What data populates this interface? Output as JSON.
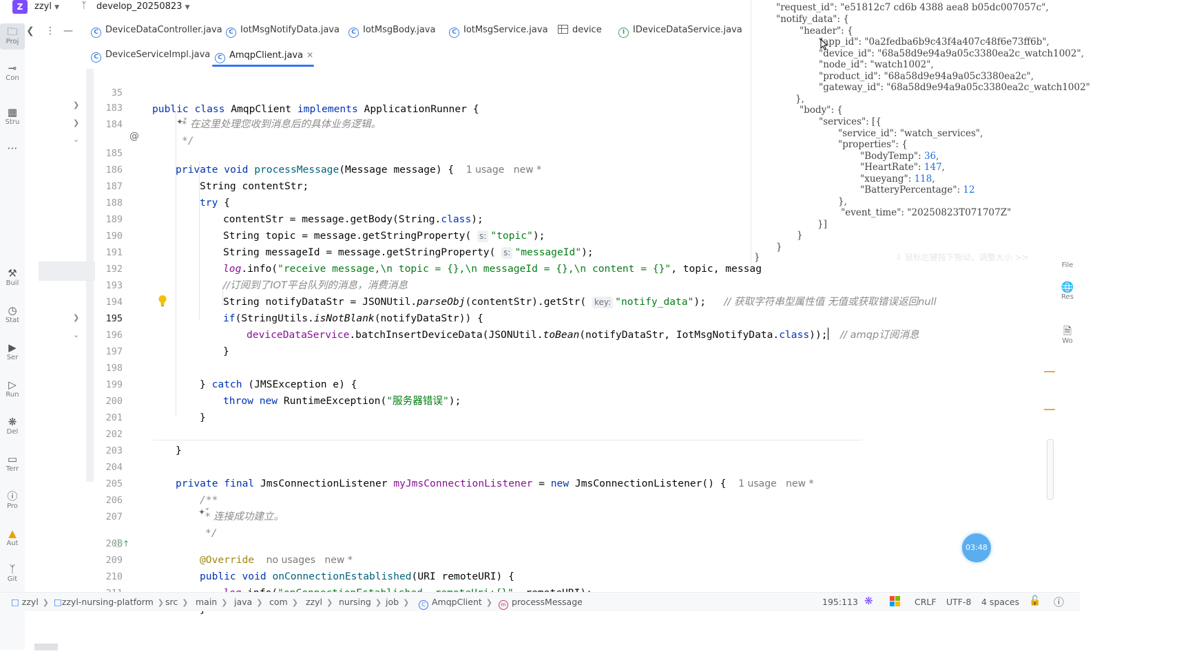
{
  "topbar": {
    "project_letter": "Z",
    "project_name": "zzyl",
    "branch": "develop_20250823"
  },
  "toolstrip": [
    {
      "name": "project",
      "label": "Proj"
    },
    {
      "name": "commit",
      "label": "Con"
    },
    {
      "name": "structure",
      "label": "Stru"
    },
    {
      "name": "more",
      "label": ""
    },
    {
      "name": "build",
      "label": "Buil"
    },
    {
      "name": "statistic",
      "label": "Stat"
    },
    {
      "name": "services",
      "label": "Ser"
    },
    {
      "name": "run",
      "label": "Run"
    },
    {
      "name": "debug",
      "label": "Del"
    },
    {
      "name": "terminal",
      "label": "Terr"
    },
    {
      "name": "problems",
      "label": "Pro"
    },
    {
      "name": "auto",
      "label": "Aut"
    },
    {
      "name": "git",
      "label": "Git"
    }
  ],
  "tabs_row1": [
    {
      "label": "DeviceDataController.java",
      "kind": "class"
    },
    {
      "label": "IotMsgNotifyData.java",
      "kind": "class"
    },
    {
      "label": "IotMsgBody.java",
      "kind": "class"
    },
    {
      "label": "IotMsgService.java",
      "kind": "class"
    },
    {
      "label": "device",
      "kind": "table"
    },
    {
      "label": "IDeviceDataService.java",
      "kind": "interface"
    }
  ],
  "tabs_row2": [
    {
      "label": "DeviceServiceImpl.java",
      "kind": "class"
    },
    {
      "label": "AmqpClient.java",
      "kind": "class",
      "active": true
    }
  ],
  "editor": {
    "lines": [
      {
        "n": "35",
        "code": "public class AmqpClient implements ApplicationRunner {"
      },
      {
        "n": "183",
        "code": "* 在这里处理您收到消息后的具体业务逻辑。"
      },
      {
        "n": "184",
        "code": "*/"
      },
      {
        "n": "185",
        "code": "private void processMessage(Message message) {",
        "hint": "1 usage   new *"
      },
      {
        "n": "186",
        "code": "String contentStr;"
      },
      {
        "n": "187",
        "code": "try {"
      },
      {
        "n": "188",
        "code": "contentStr = message.getBody(String.class);"
      },
      {
        "n": "189",
        "code": "String topic = message.getStringProperty( s: \"topic\");"
      },
      {
        "n": "190",
        "code": "String messageId = message.getStringProperty( s: \"messageId\");"
      },
      {
        "n": "191",
        "code": "log.info(\"receive message,\\n topic = {},\\n messageId = {},\\n content = {}\", topic, messag"
      },
      {
        "n": "192",
        "code": "//订阅到了IOT平台队列的消息，消费消息"
      },
      {
        "n": "193",
        "code": "String notifyDataStr = JSONUtil.parseObj(contentStr).getStr( key: \"notify_data\");",
        "comment": "// 获取字符串型属性值 无值或获取错误返回null"
      },
      {
        "n": "194",
        "code": "if(StringUtils.isNotBlank(notifyDataStr)) {"
      },
      {
        "n": "195",
        "code": "deviceDataService.batchInsertDeviceData(JSONUtil.toBean(notifyDataStr, IotMsgNotifyData.class));",
        "comment": "// amqp订阅消息"
      },
      {
        "n": "196",
        "code": "}"
      },
      {
        "n": "197",
        "code": ""
      },
      {
        "n": "198",
        "code": "} catch (JMSException e) {"
      },
      {
        "n": "199",
        "code": "throw new RuntimeException(\"服务器错误\");"
      },
      {
        "n": "200",
        "code": "}"
      },
      {
        "n": "201",
        "code": ""
      },
      {
        "n": "202",
        "code": "}"
      },
      {
        "n": "203",
        "code": ""
      },
      {
        "n": "204",
        "code": "private final JmsConnectionListener myJmsConnectionListener = new JmsConnectionListener() {",
        "hint": "1 usage   new *"
      },
      {
        "n": "205",
        "code": "/**"
      },
      {
        "n": "206",
        "code": "* 连接成功建立。"
      },
      {
        "n": "207",
        "code": "*/"
      },
      {
        "n": "208",
        "code": "@Override",
        "hint": "no usages   new *"
      },
      {
        "n": "209",
        "code": "public void onConnectionEstablished(URI remoteURI) {"
      },
      {
        "n": "210",
        "code": "log.info(\"onConnectionEstablished, remoteUri:{}\", remoteURI);"
      },
      {
        "n": "211",
        "code": "}"
      }
    ]
  },
  "json_overlay": {
    "lines": [
      "\"request_id\": \"e51812c7 cd6b 4388 aea8 b05dc007057c\",",
      "\"notify_data\": {",
      "\"header\": {",
      "\"app_id\": \"0a2fedba6b9c43f4a407c48f6e73ff6b\",",
      "\"device_id\": \"68a58d9e94a9a05c3380ea2c_watch1002\",",
      "\"node_id\": \"watch1002\",",
      "\"product_id\": \"68a58d9e94a9a05c3380ea2c\",",
      "\"gateway_id\": \"68a58d9e94a9a05c3380ea2c_watch1002\"",
      "},",
      "\"body\": {",
      "\"services\": [{",
      "\"service_id\": \"watch_services\",",
      "\"properties\": {",
      "\"BodyTemp\": 36,",
      "\"HeartRate\": 147,",
      "\"xueyang\": 118,",
      "\"BatteryPercentage\": 12",
      "},",
      "\"event_time\": \"20250823T071707Z\"",
      "}]",
      "}",
      "}",
      "}"
    ],
    "faded_hint": "⇩ 鼠标左键按下拖动，调整大小 >>"
  },
  "right_tools": [
    {
      "name": "file",
      "label": "File"
    },
    {
      "name": "rest",
      "label": "Res"
    },
    {
      "name": "word",
      "label": "Wo"
    }
  ],
  "timer": "03:48",
  "statusbar": {
    "breadcrumbs": [
      "zzyl",
      "zzyl-nursing-platform",
      "src",
      "main",
      "java",
      "com",
      "zzyl",
      "nursing",
      "job",
      "AmqpClient",
      "processMessage"
    ],
    "position": "195:113",
    "line_ending": "CRLF",
    "encoding": "UTF-8",
    "indent": "4 spaces"
  },
  "colors": {
    "keyword": "#0033b3",
    "string": "#067d17",
    "comment": "#8c8c8c",
    "method": "#00627a",
    "accent": "#3574f0",
    "project_badge": "#7c4dff"
  }
}
